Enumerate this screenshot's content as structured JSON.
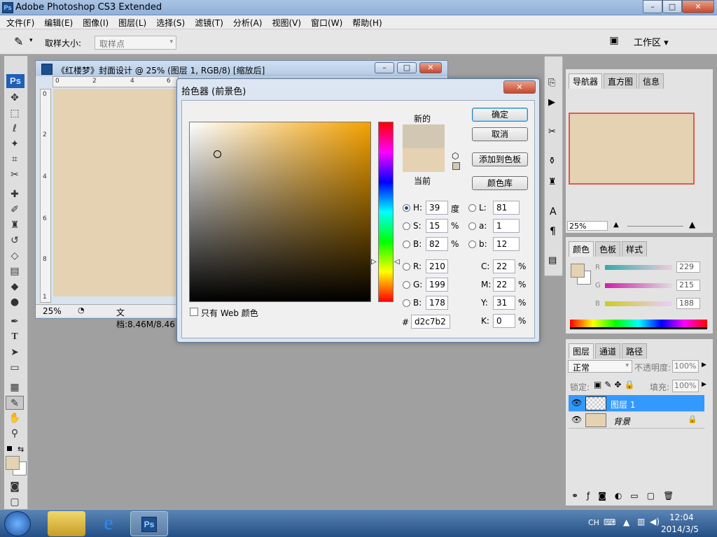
{
  "app": {
    "title": "Adobe Photoshop CS3 Extended",
    "icon_label": "Ps",
    "window_buttons": [
      "–",
      "□",
      "✕"
    ]
  },
  "menu": [
    "文件(F)",
    "编辑(E)",
    "图像(I)",
    "图层(L)",
    "选择(S)",
    "滤镜(T)",
    "分析(A)",
    "视图(V)",
    "窗口(W)",
    "帮助(H)"
  ],
  "options_bar": {
    "sample_size_label": "取样大小:",
    "sample_size_value": "取样点",
    "workspace_label": "工作区 ▾"
  },
  "toolbox": {
    "logo": "Ps"
  },
  "document": {
    "title": "《红楼梦》封面设计 @ 25% (图层 1, RGB/8) [缩放后]",
    "zoom": "25%",
    "doc_info": "文档:8.46M/8.46",
    "ruler_h": [
      "0",
      "2",
      "4",
      "6"
    ],
    "ruler_v": [
      "0",
      "2",
      "4",
      "6",
      "8",
      "1"
    ],
    "canvas_color": "#e4d2b2"
  },
  "picker": {
    "title": "拾色器 (前景色)",
    "new_label": "新的",
    "current_label": "当前",
    "buttons": {
      "ok": "确定",
      "cancel": "取消",
      "add_swatches": "添加到色板",
      "libraries": "颜色库"
    },
    "only_web_colors": "只有 Web 颜色",
    "hsb": [
      {
        "label": "H:",
        "value": "39",
        "unit": "度",
        "selected": true
      },
      {
        "label": "S:",
        "value": "15",
        "unit": "%"
      },
      {
        "label": "B:",
        "value": "82",
        "unit": "%"
      }
    ],
    "rgb": [
      {
        "label": "R:",
        "value": "210"
      },
      {
        "label": "G:",
        "value": "199"
      },
      {
        "label": "B:",
        "value": "178"
      }
    ],
    "lab": [
      {
        "label": "L:",
        "value": "81"
      },
      {
        "label": "a:",
        "value": "1"
      },
      {
        "label": "b:",
        "value": "12"
      }
    ],
    "cmyk": [
      {
        "label": "C:",
        "value": "22",
        "unit": "%"
      },
      {
        "label": "M:",
        "value": "22",
        "unit": "%"
      },
      {
        "label": "Y:",
        "value": "31",
        "unit": "%"
      },
      {
        "label": "K:",
        "value": "0",
        "unit": "%"
      }
    ],
    "hex_label": "#",
    "hex": "d2c7b2",
    "new_color": "#d2c7b2",
    "current_color": "#e4d2b2"
  },
  "navigator_panel": {
    "tabs": [
      "导航器",
      "直方图",
      "信息"
    ],
    "zoom": "25%"
  },
  "color_panel": {
    "tabs": [
      "颜色",
      "色板",
      "样式"
    ],
    "channels": [
      {
        "label": "R",
        "value": "229"
      },
      {
        "label": "G",
        "value": "215"
      },
      {
        "label": "B",
        "value": "188"
      }
    ]
  },
  "layers_panel": {
    "tabs": [
      "图层",
      "通道",
      "路径"
    ],
    "blend_mode": "正常",
    "opacity_label": "不透明度:",
    "opacity": "100%",
    "lock_label": "锁定:",
    "fill_label": "填充:",
    "fill": "100%",
    "layers": [
      {
        "name": "图层 1",
        "selected": true
      },
      {
        "name": "背景",
        "selected": false
      }
    ]
  },
  "taskbar": {
    "ime": "CH",
    "time": "12:04",
    "date": "2014/3/5"
  }
}
